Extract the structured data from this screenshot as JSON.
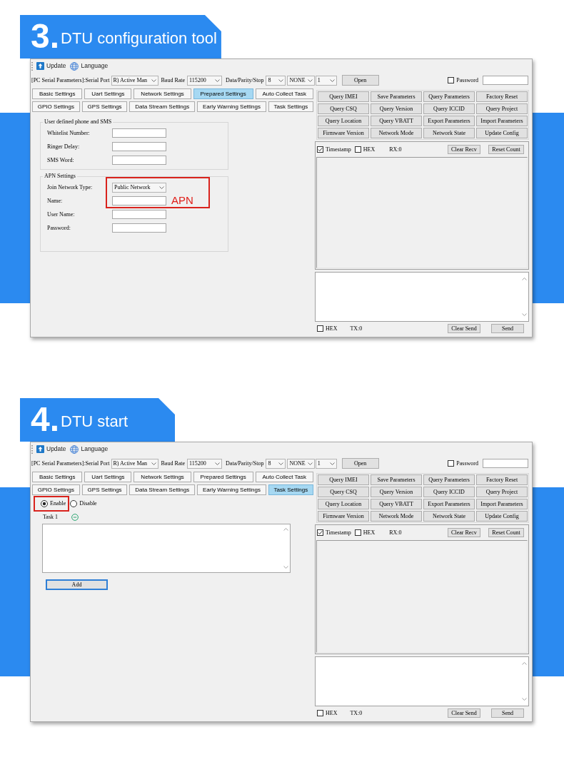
{
  "sections": [
    {
      "number": "3.",
      "title": "DTU configuration tool",
      "window": {
        "toolbar": [
          {
            "kind": "update",
            "label": "Update"
          },
          {
            "kind": "language",
            "label": "Language"
          }
        ],
        "serial_bar": {
          "caption": "[PC Serial Parameters]:Serial Port",
          "port": "R) Active Man",
          "baud_label": "Baud Rate",
          "baud_rate": "115200",
          "frame_label": "Data/Parity/Stop",
          "data_bits": "8",
          "parity": "NONE",
          "stop_bits": "1",
          "open_button": "Open",
          "password": {
            "label": "Password",
            "checked": false
          }
        },
        "tabs": [
          [
            {
              "label": "Basic Settings",
              "selected": false
            },
            {
              "label": "Uart Settings",
              "selected": false
            },
            {
              "label": "Network Settings",
              "selected": false
            },
            {
              "label": "Prepared Settings",
              "selected": true
            },
            {
              "label": "Auto Collect Task",
              "selected": false
            }
          ],
          [
            {
              "label": "GPIO Settings",
              "selected": false
            },
            {
              "label": "GPS Settings",
              "selected": false
            },
            {
              "label": "Data Stream Settings",
              "selected": false
            },
            {
              "label": "Early Warning Settings",
              "selected": false
            },
            {
              "label": "Task Settings",
              "selected": false
            }
          ]
        ],
        "panel": {
          "kind": "form",
          "groups": [
            {
              "title": "User defined phone and SMS",
              "fields": [
                {
                  "label": "Whitelist Number:",
                  "kind": "input",
                  "highlighted": false
                },
                {
                  "label": "Ringer Delay:",
                  "kind": "input",
                  "highlighted": false
                },
                {
                  "label": "SMS Word:",
                  "kind": "input",
                  "highlighted": false
                }
              ]
            },
            {
              "title": "APN Settings",
              "annotation": "APN",
              "fields": [
                {
                  "label": "Join Network Type:",
                  "kind": "select",
                  "value": "Public Network",
                  "highlighted": true
                },
                {
                  "label": "Name:",
                  "kind": "input",
                  "highlighted": true
                },
                {
                  "label": "User Name:",
                  "kind": "input",
                  "highlighted": false
                },
                {
                  "label": "Password:",
                  "kind": "input",
                  "highlighted": false
                }
              ]
            }
          ]
        },
        "command_buttons": [
          [
            "Query IMEI",
            "Save Parameters",
            "Query Parameters",
            "Factory Reset"
          ],
          [
            "Query CSQ",
            "Query Version",
            "Query ICCID",
            "Query Project"
          ],
          [
            "Query Location",
            "Query VBATT",
            "Export Parameters",
            "Import Parameters"
          ],
          [
            "Firmware Version",
            "Network Mode",
            "Network State",
            "Update Config"
          ]
        ],
        "receive": {
          "timestamp": {
            "label": "Timestamp",
            "checked": true
          },
          "hex": {
            "label": "HEX",
            "checked": false
          },
          "counter": "RX:0",
          "buttons": [
            "Clear Recv",
            "Reset Count"
          ]
        },
        "send": {
          "hex": {
            "label": "HEX",
            "checked": false
          },
          "counter": "TX:0",
          "buttons": [
            "Clear Send",
            "Send"
          ]
        }
      }
    },
    {
      "number": "4.",
      "title": "DTU start",
      "window": {
        "toolbar": [
          {
            "kind": "update",
            "label": "Update"
          },
          {
            "kind": "language",
            "label": "Language"
          }
        ],
        "serial_bar": {
          "caption": "[PC Serial Parameters]:Serial Port",
          "port": "R) Active Man",
          "baud_label": "Baud Rate",
          "baud_rate": "115200",
          "frame_label": "Data/Parity/Stop",
          "data_bits": "8",
          "parity": "NONE",
          "stop_bits": "1",
          "open_button": "Open",
          "password": {
            "label": "Password",
            "checked": false
          }
        },
        "tabs": [
          [
            {
              "label": "Basic Settings",
              "selected": false
            },
            {
              "label": "Uart Settings",
              "selected": false
            },
            {
              "label": "Network Settings",
              "selected": false
            },
            {
              "label": "Prepared Settings",
              "selected": false
            },
            {
              "label": "Auto Collect Task",
              "selected": false
            }
          ],
          [
            {
              "label": "GPIO Settings",
              "selected": false
            },
            {
              "label": "GPS Settings",
              "selected": false
            },
            {
              "label": "Data Stream Settings",
              "selected": false
            },
            {
              "label": "Early Warning Settings",
              "selected": false
            },
            {
              "label": "Task Settings",
              "selected": true
            }
          ]
        ],
        "panel": {
          "kind": "tasks",
          "modes": [
            {
              "label": "Enable",
              "selected": true,
              "highlighted": true
            },
            {
              "label": "Disable",
              "selected": false,
              "highlighted": false
            }
          ],
          "tasks": [
            {
              "label": "Task 1"
            }
          ],
          "add_button": {
            "label": "Add",
            "focused": true
          }
        },
        "command_buttons": [
          [
            "Query IMEI",
            "Save Parameters",
            "Query Parameters",
            "Factory Reset"
          ],
          [
            "Query CSQ",
            "Query Version",
            "Query ICCID",
            "Query Project"
          ],
          [
            "Query Location",
            "Query VBATT",
            "Export Parameters",
            "Import Parameters"
          ],
          [
            "Firmware Version",
            "Network Mode",
            "Network State",
            "Update Config"
          ]
        ],
        "receive": {
          "timestamp": {
            "label": "Timestamp",
            "checked": true
          },
          "hex": {
            "label": "HEX",
            "checked": false
          },
          "counter": "RX:0",
          "buttons": [
            "Clear Recv",
            "Reset Count"
          ]
        },
        "send": {
          "hex": {
            "label": "HEX",
            "checked": false
          },
          "counter": "TX:0",
          "buttons": [
            "Clear Send",
            "Send"
          ]
        }
      }
    }
  ]
}
